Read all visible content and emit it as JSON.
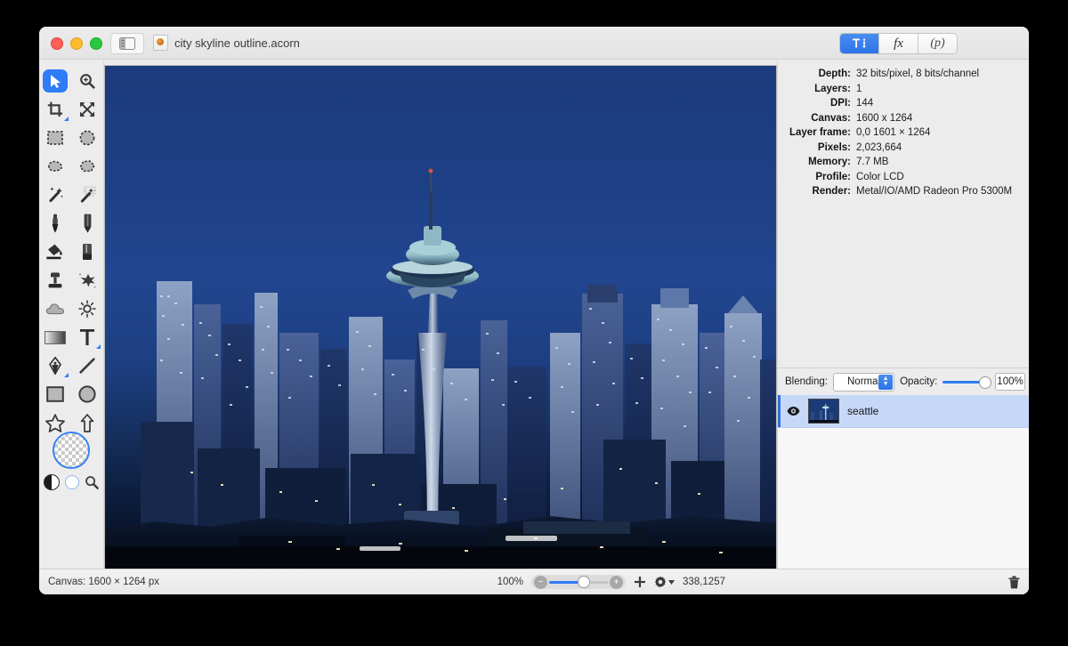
{
  "window": {
    "title": "city skyline outline.acorn",
    "traffic_lights": [
      "close",
      "minimize",
      "zoom"
    ],
    "sidebar_toggle_icon": "sidebar-toggle-icon",
    "document_icon": "acorn-document-icon"
  },
  "inspector_tabs": [
    {
      "id": "info",
      "label": "",
      "icon": "tools-inspector-icon",
      "active": true
    },
    {
      "id": "filters",
      "label": "fx",
      "icon": "fx-icon",
      "active": false
    },
    {
      "id": "presets",
      "label": "(p)",
      "icon": "presets-icon",
      "active": false
    }
  ],
  "tools": [
    {
      "name": "move-tool",
      "icon": "cursor-arrow-icon",
      "active": true,
      "group": false
    },
    {
      "name": "zoom-tool",
      "icon": "magnifier-icon",
      "active": false,
      "group": false
    },
    {
      "name": "crop-tool",
      "icon": "crop-icon",
      "active": false,
      "group": true
    },
    {
      "name": "transform-tool",
      "icon": "move-arrows-icon",
      "active": false,
      "group": false
    },
    {
      "name": "rectangular-select-tool",
      "icon": "rect-marquee-icon",
      "active": false,
      "group": false
    },
    {
      "name": "elliptical-select-tool",
      "icon": "ellipse-marquee-icon",
      "active": false,
      "group": false
    },
    {
      "name": "lasso-tool",
      "icon": "lasso-icon",
      "active": false,
      "group": false
    },
    {
      "name": "polygon-lasso-tool",
      "icon": "polygon-lasso-icon",
      "active": false,
      "group": false
    },
    {
      "name": "magic-wand-tool",
      "icon": "magic-wand-icon",
      "active": false,
      "group": false
    },
    {
      "name": "select-similar-tool",
      "icon": "magic-wand-dotted-icon",
      "active": false,
      "group": false
    },
    {
      "name": "brush-tool",
      "icon": "brush-icon",
      "active": false,
      "group": false
    },
    {
      "name": "pencil-tool",
      "icon": "pencil-icon",
      "active": false,
      "group": false
    },
    {
      "name": "paint-bucket-tool",
      "icon": "paint-bucket-icon",
      "active": false,
      "group": false
    },
    {
      "name": "eraser-tool",
      "icon": "eraser-icon",
      "active": false,
      "group": false
    },
    {
      "name": "clone-stamp-tool",
      "icon": "clone-stamp-icon",
      "active": false,
      "group": false
    },
    {
      "name": "smudge-tool",
      "icon": "smudge-icon",
      "active": false,
      "group": false
    },
    {
      "name": "blur-tool",
      "icon": "cloud-icon",
      "active": false,
      "group": false
    },
    {
      "name": "dodge-tool",
      "icon": "sun-icon",
      "active": false,
      "group": false
    },
    {
      "name": "gradient-tool",
      "icon": "gradient-icon",
      "active": false,
      "group": false
    },
    {
      "name": "text-tool",
      "icon": "text-t-icon",
      "active": false,
      "group": true
    },
    {
      "name": "pen-tool",
      "icon": "pen-nib-icon",
      "active": false,
      "group": true
    },
    {
      "name": "line-tool",
      "icon": "line-icon",
      "active": false,
      "group": false
    },
    {
      "name": "rectangle-shape-tool",
      "icon": "square-icon",
      "active": false,
      "group": false
    },
    {
      "name": "ellipse-shape-tool",
      "icon": "circle-icon",
      "active": false,
      "group": false
    },
    {
      "name": "star-shape-tool",
      "icon": "star-icon",
      "active": false,
      "group": false
    },
    {
      "name": "arrow-shape-tool",
      "icon": "arrow-up-icon",
      "active": false,
      "group": false
    }
  ],
  "color_well": {
    "name": "foreground-color-well",
    "value": "transparent",
    "swatch_icon": "half-circle-swatch-icon",
    "reset_icon": "reset-colors-icon",
    "picker_icon": "color-picker-magnifier-icon"
  },
  "inspector": {
    "rows": [
      {
        "label": "Depth:",
        "value": "32 bits/pixel, 8 bits/channel"
      },
      {
        "label": "Layers:",
        "value": "1"
      },
      {
        "label": "DPI:",
        "value": "144"
      },
      {
        "label": "Canvas:",
        "value": "1600 x 1264"
      },
      {
        "label": "Layer frame:",
        "value": "0,0 1601 × 1264"
      },
      {
        "label": "Pixels:",
        "value": "2,023,664"
      },
      {
        "label": "Memory:",
        "value": "7.7 MB"
      },
      {
        "label": "Profile:",
        "value": "Color LCD"
      },
      {
        "label": "Render:",
        "value": "Metal/IO/AMD Radeon Pro 5300M"
      }
    ]
  },
  "blending": {
    "label": "Blending:",
    "mode": "Normal",
    "modes": [
      "Normal"
    ],
    "opacity_label": "Opacity:",
    "opacity_value": "100%",
    "opacity_percent": 100
  },
  "layers": [
    {
      "name": "seattle",
      "visible": true,
      "selected": true,
      "eye_icon": "eye-icon",
      "thumbnail": "layer-thumbnail"
    }
  ],
  "statusbar": {
    "canvas_info": "Canvas: 1600 × 1264 px",
    "zoom_level": "100%",
    "zoom_out_icon": "zoom-out-icon",
    "zoom_in_icon": "zoom-in-icon",
    "add_layer_icon": "plus-icon",
    "layer_actions_icon": "gear-icon",
    "coordinates": "338,1257",
    "delete_icon": "trash-icon"
  },
  "colors": {
    "accent": "#2f7cf6",
    "selection": "#c6d8f8",
    "chrome": "#ececec",
    "sky_top": "#1c3b7d",
    "sky_bottom": "#03070f"
  }
}
